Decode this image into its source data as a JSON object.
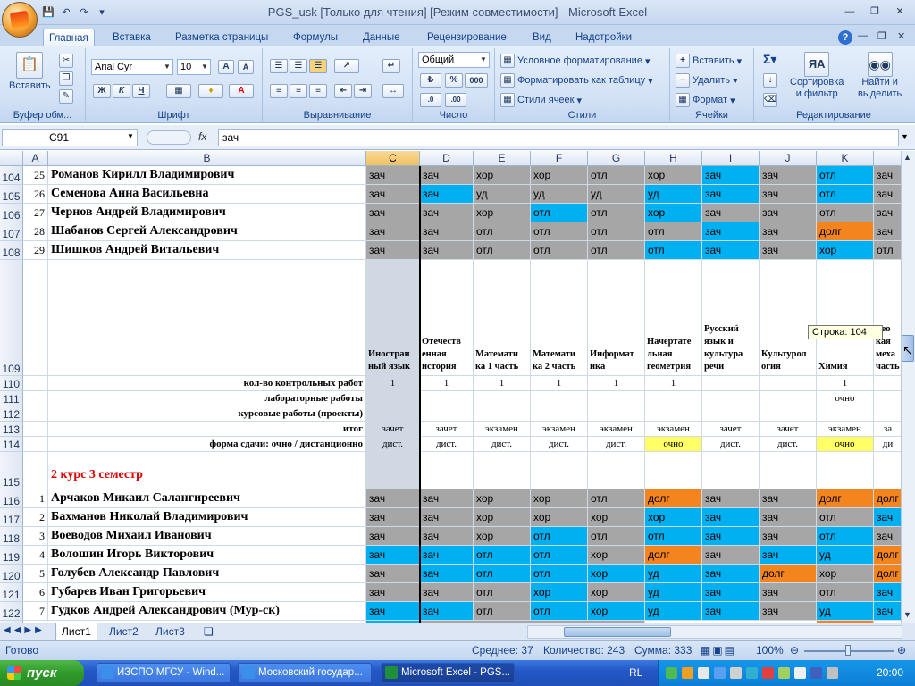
{
  "window": {
    "title": "PGS_usk  [Только для чтения]  [Режим совместимости] - Microsoft Excel"
  },
  "tabs": [
    "Главная",
    "Вставка",
    "Разметка страницы",
    "Формулы",
    "Данные",
    "Рецензирование",
    "Вид",
    "Надстройки"
  ],
  "ribbon": {
    "clipboard": {
      "label": "Буфер обм...",
      "paste": "Вставить"
    },
    "font": {
      "label": "Шрифт",
      "font_name": "Arial Cyr",
      "font_size": "10",
      "bold": "Ж",
      "italic": "К",
      "underline": "Ч"
    },
    "alignment": {
      "label": "Выравнивание"
    },
    "number": {
      "label": "Число",
      "format": "Общий",
      "percent": "%",
      "thousands": "000"
    },
    "styles": {
      "label": "Стили",
      "conditional": "Условное форматирование",
      "format_table": "Форматировать как таблицу",
      "cell_styles": "Стили ячеек"
    },
    "cells": {
      "label": "Ячейки",
      "insert": "Вставить",
      "delete": "Удалить",
      "format": "Формат"
    },
    "editing": {
      "label": "Редактирование",
      "sort": "Сортировка",
      "sort2": "и фильтр",
      "find": "Найти и",
      "find2": "выделить"
    }
  },
  "formula_bar": {
    "name_box": "C91",
    "fx": "fx",
    "value": "зач"
  },
  "columns": [
    "A",
    "B",
    "C",
    "D",
    "E",
    "F",
    "G",
    "H",
    "I",
    "J",
    "K"
  ],
  "colors": {
    "gray": "#a6a6a6",
    "cyan": "#00b0f0",
    "orange": "#f4841e",
    "yellow": "#ffff66"
  },
  "students_top": [
    {
      "row": "104",
      "num": "25",
      "name": "Романов Кирилл Владимирович",
      "cells": [
        [
          "зач",
          "g"
        ],
        [
          "зач",
          "g"
        ],
        [
          "хор",
          "g"
        ],
        [
          "хор",
          "g"
        ],
        [
          "отл",
          "g"
        ],
        [
          "хор",
          "g"
        ],
        [
          "зач",
          "c"
        ],
        [
          "зач",
          "g"
        ],
        [
          "отл",
          "c"
        ],
        [
          "зач",
          "g"
        ]
      ]
    },
    {
      "row": "105",
      "num": "26",
      "name": "Семенова Анна Васильевна",
      "cells": [
        [
          "зач",
          "g"
        ],
        [
          "зач",
          "c"
        ],
        [
          "уд",
          "g"
        ],
        [
          "уд",
          "g"
        ],
        [
          "уд",
          "g"
        ],
        [
          "уд",
          "c"
        ],
        [
          "зач",
          "c"
        ],
        [
          "зач",
          "g"
        ],
        [
          "отл",
          "c"
        ],
        [
          "зач",
          "g"
        ]
      ]
    },
    {
      "row": "106",
      "num": "27",
      "name": "Чернов Андрей Владимирович",
      "cells": [
        [
          "зач",
          "g"
        ],
        [
          "зач",
          "g"
        ],
        [
          "хор",
          "g"
        ],
        [
          "отл",
          "c"
        ],
        [
          "отл",
          "g"
        ],
        [
          "хор",
          "c"
        ],
        [
          "зач",
          "g"
        ],
        [
          "зач",
          "g"
        ],
        [
          "отл",
          "g"
        ],
        [
          "зач",
          "g"
        ]
      ]
    },
    {
      "row": "107",
      "num": "28",
      "name": "Шабанов Сергей Александрович",
      "cells": [
        [
          "зач",
          "g"
        ],
        [
          "зач",
          "g"
        ],
        [
          "отл",
          "g"
        ],
        [
          "отл",
          "g"
        ],
        [
          "отл",
          "g"
        ],
        [
          "отл",
          "g"
        ],
        [
          "зач",
          "c"
        ],
        [
          "зач",
          "g"
        ],
        [
          "долг",
          "o"
        ],
        [
          "зач",
          "g"
        ]
      ]
    },
    {
      "row": "108",
      "num": "29",
      "name": "Шишков Андрей Витальевич",
      "cells": [
        [
          "зач",
          "g"
        ],
        [
          "зач",
          "g"
        ],
        [
          "отл",
          "g"
        ],
        [
          "отл",
          "g"
        ],
        [
          "отл",
          "g"
        ],
        [
          "отл",
          "c"
        ],
        [
          "зач",
          "c"
        ],
        [
          "зач",
          "g"
        ],
        [
          "хор",
          "c"
        ],
        [
          "отл",
          "g"
        ]
      ]
    }
  ],
  "subjects": [
    "Иностран\nный язык",
    "Отечеств\nенная\nистория",
    "Математи\nка 1 часть",
    "Математи\nка 2 часть",
    "Информат\nика",
    "Начертате\nльная\nгеометрия",
    "Русский\nязык и\nкультура\nречи",
    "Культурол\nогия",
    "Химия",
    "Тео\nкая\nмеха\nчасть"
  ],
  "summary_rows": [
    {
      "row": "110",
      "label": "кол-во контрольных работ",
      "values": [
        "1",
        "1",
        "1",
        "1",
        "1",
        "1",
        "",
        "",
        "1",
        ""
      ]
    },
    {
      "row": "111",
      "label": "лабораторные работы",
      "values": [
        "",
        "",
        "",
        "",
        "",
        "",
        "",
        "",
        "очно",
        ""
      ]
    },
    {
      "row": "112",
      "label": "курсовые работы (проекты)",
      "values": [
        "",
        "",
        "",
        "",
        "",
        "",
        "",
        "",
        "",
        ""
      ]
    },
    {
      "row": "113",
      "label": "итог",
      "values": [
        "зачет",
        "зачет",
        "экзамен",
        "экзамен",
        "экзамен",
        "экзамен",
        "зачет",
        "зачет",
        "экзамен",
        "за"
      ]
    },
    {
      "row": "114",
      "label": "форма сдачи: очно / дистанционно",
      "values": [
        "дист.",
        "дист.",
        "дист.",
        "дист.",
        "дист.",
        "очно",
        "дист.",
        "дист.",
        "очно",
        "ди"
      ]
    }
  ],
  "section_title": "2 курс 3 семестр",
  "students_bottom": [
    {
      "row": "116",
      "num": "1",
      "name": "Арчаков Микаил Салангиреевич",
      "cells": [
        [
          "зач",
          "g"
        ],
        [
          "зач",
          "g"
        ],
        [
          "хор",
          "g"
        ],
        [
          "хор",
          "g"
        ],
        [
          "отл",
          "g"
        ],
        [
          "долг",
          "o"
        ],
        [
          "зач",
          "g"
        ],
        [
          "зач",
          "g"
        ],
        [
          "долг",
          "o"
        ],
        [
          "долг",
          "o"
        ]
      ]
    },
    {
      "row": "117",
      "num": "2",
      "name": "Бахманов Николай Владимирович",
      "cells": [
        [
          "зач",
          "g"
        ],
        [
          "зач",
          "g"
        ],
        [
          "хор",
          "g"
        ],
        [
          "хор",
          "g"
        ],
        [
          "хор",
          "g"
        ],
        [
          "хор",
          "c"
        ],
        [
          "зач",
          "c"
        ],
        [
          "зач",
          "g"
        ],
        [
          "отл",
          "g"
        ],
        [
          "зач",
          "c"
        ]
      ]
    },
    {
      "row": "118",
      "num": "3",
      "name": "Воеводов Михаил Иванович",
      "cells": [
        [
          "зач",
          "g"
        ],
        [
          "зач",
          "g"
        ],
        [
          "хор",
          "g"
        ],
        [
          "отл",
          "c"
        ],
        [
          "отл",
          "g"
        ],
        [
          "отл",
          "c"
        ],
        [
          "зач",
          "c"
        ],
        [
          "зач",
          "g"
        ],
        [
          "отл",
          "c"
        ],
        [
          "зач",
          "g"
        ]
      ]
    },
    {
      "row": "119",
      "num": "4",
      "name": "Волошин Игорь Викторович",
      "cells": [
        [
          "зач",
          "c"
        ],
        [
          "зач",
          "c"
        ],
        [
          "отл",
          "c"
        ],
        [
          "отл",
          "c"
        ],
        [
          "хор",
          "g"
        ],
        [
          "долг",
          "o"
        ],
        [
          "зач",
          "g"
        ],
        [
          "зач",
          "c"
        ],
        [
          "уд",
          "c"
        ],
        [
          "долг",
          "o"
        ]
      ]
    },
    {
      "row": "120",
      "num": "5",
      "name": "Голубев Александр Павлович",
      "cells": [
        [
          "зач",
          "g"
        ],
        [
          "зач",
          "c"
        ],
        [
          "отл",
          "c"
        ],
        [
          "отл",
          "c"
        ],
        [
          "хор",
          "c"
        ],
        [
          "уд",
          "c"
        ],
        [
          "зач",
          "c"
        ],
        [
          "долг",
          "o"
        ],
        [
          "хор",
          "g"
        ],
        [
          "долг",
          "o"
        ]
      ]
    },
    {
      "row": "121",
      "num": "6",
      "name": "Губарев Иван Григорьевич",
      "cells": [
        [
          "зач",
          "g"
        ],
        [
          "зач",
          "g"
        ],
        [
          "отл",
          "g"
        ],
        [
          "хор",
          "c"
        ],
        [
          "хор",
          "g"
        ],
        [
          "уд",
          "c"
        ],
        [
          "зач",
          "c"
        ],
        [
          "зач",
          "g"
        ],
        [
          "отл",
          "g"
        ],
        [
          "зач",
          "c"
        ]
      ]
    },
    {
      "row": "122",
      "num": "7",
      "name": "Гудков Андрей Александрович (Мур-ск)",
      "cells": [
        [
          "зач",
          "c"
        ],
        [
          "зач",
          "c"
        ],
        [
          "отл",
          "g"
        ],
        [
          "отл",
          "c"
        ],
        [
          "хор",
          "c"
        ],
        [
          "уд",
          "c"
        ],
        [
          "зач",
          "c"
        ],
        [
          "зач",
          "g"
        ],
        [
          "уд",
          "c"
        ],
        [
          "зач",
          "c"
        ]
      ]
    }
  ],
  "row_headers_misc": {
    "r109": "109",
    "r115": "115",
    "r123": "123"
  },
  "partial_next_name": "Г... М... В...",
  "tooltip": "Строка: 104",
  "sheets": [
    "Лист1",
    "Лист2",
    "Лист3"
  ],
  "status": {
    "ready": "Готово",
    "average": "Среднее: 37",
    "count": "Количество: 243",
    "sum": "Сумма: 333",
    "zoom": "100%"
  },
  "taskbar": {
    "start": "пуск",
    "tasks": [
      "ИЗСПО МГСУ - Wind...",
      "Московский государ...",
      "Microsoft Excel - PGS..."
    ],
    "lang": "RL",
    "clock": "20:00"
  }
}
